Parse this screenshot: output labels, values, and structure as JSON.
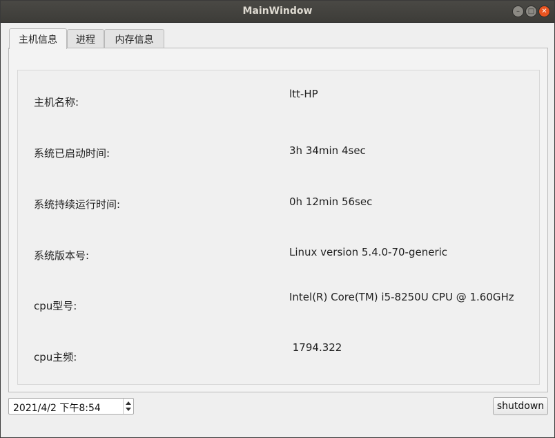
{
  "window": {
    "title": "MainWindow"
  },
  "tabs": [
    {
      "label": "主机信息",
      "active": true
    },
    {
      "label": "进程",
      "active": false
    },
    {
      "label": "内存信息",
      "active": false
    }
  ],
  "host_info": {
    "rows": [
      {
        "label": "主机名称:",
        "value": "ltt-HP"
      },
      {
        "label": "系统已启动时间:",
        "value": "3h 34min 4sec"
      },
      {
        "label": "系统持续运行时间:",
        "value": "0h 12min 56sec"
      },
      {
        "label": "系统版本号:",
        "value": "Linux version 5.4.0-70-generic"
      },
      {
        "label": "cpu型号:",
        "value": "Intel(R) Core(TM) i5-8250U CPU @ 1.60GHz"
      },
      {
        "label": "cpu主频:",
        "value": " 1794.322"
      }
    ]
  },
  "footer": {
    "datetime": "2021/4/2 下午8:54",
    "shutdown_label": "shutdown"
  },
  "icons": {
    "minimize": "minimize-icon",
    "maximize": "maximize-icon",
    "close": "close-icon"
  },
  "colors": {
    "close_button": "#e95420",
    "titlebar": "#45443f"
  }
}
